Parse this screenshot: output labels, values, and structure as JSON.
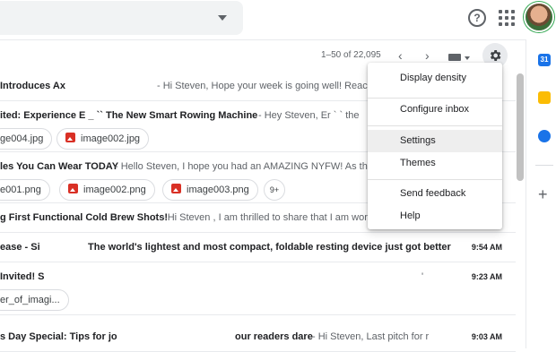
{
  "header": {
    "help_glyph": "?"
  },
  "toolbar": {
    "page_range": "1–50 of 22,095",
    "prev_glyph": "‹",
    "next_glyph": "›"
  },
  "emails": [
    {
      "sender": "Introduces Ax",
      "subject": "",
      "snippet": "- Hi Steven, Hope your week is going well! Reachi",
      "time": ""
    },
    {
      "sender": "ited: Experience E _ `` The New Smart Rowing Machine",
      "subject": "",
      "snippet": "- Hey Steven, Er ` ` the",
      "time": "",
      "attachments": [
        "ge004.jpg",
        "image002.jpg"
      ]
    },
    {
      "sender": "les You Can Wear TODAY",
      "subject": "",
      "snippet": "- Hello Steven, I hope you had an AMAZING NYFW! As the",
      "time": "",
      "attachments": [
        "e001.png",
        "image002.png",
        "image003.png"
      ],
      "more": "9+"
    },
    {
      "sender": "g First Functional Cold Brew Shots!",
      "subject": "",
      "snippet": "- Hi Steven , I am thrilled to share that I am wor",
      "time": ""
    },
    {
      "sender": "ease - Si",
      "subject": "The world's lightest and most compact, foldable resting device just got better",
      "snippet": "",
      "time": "9:54 AM"
    },
    {
      "sender": "Invited! S",
      "subject": "",
      "snippet": "'",
      "time": "9:23 AM",
      "attachments": [
        "er_of_imagi..."
      ]
    },
    {
      "sender": "s Day Special: Tips for jo",
      "subject": "our readers dare",
      "snippet": "- Hi Steven, Last pitch for r",
      "time": "9:03 AM"
    }
  ],
  "settings_menu": {
    "items": [
      {
        "label": "Display density"
      },
      {
        "label": "Configure inbox"
      },
      {
        "label": "Settings",
        "highlighted": true
      },
      {
        "label": "Themes"
      },
      {
        "label": "Send feedback"
      },
      {
        "label": "Help"
      }
    ]
  },
  "side_panel": {
    "calendar_glyph": "31",
    "add_glyph": "+"
  },
  "colors": {
    "accent": "#1a73e8",
    "attachment_icon": "#d93025",
    "keep": "#fbbc04"
  }
}
